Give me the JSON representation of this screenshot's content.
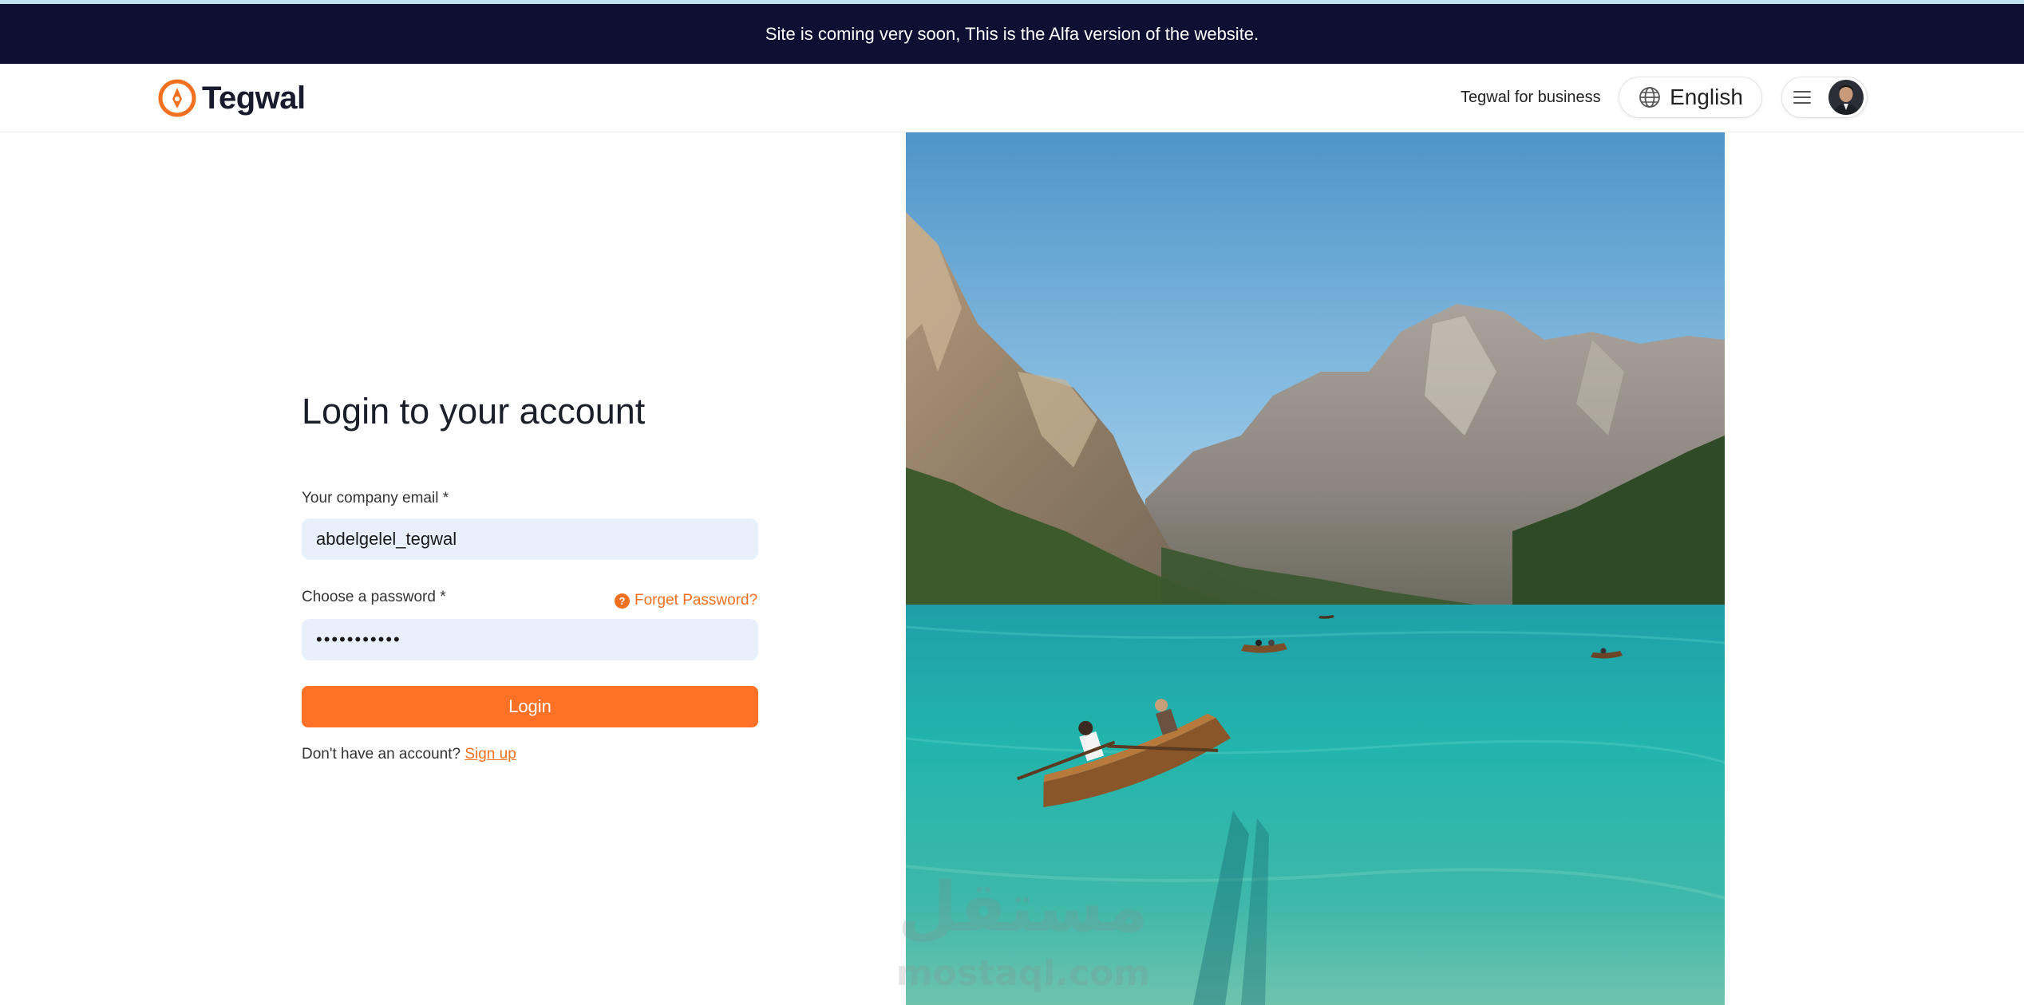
{
  "banner": {
    "text": "Site is coming very soon, This is the Alfa version of the website."
  },
  "header": {
    "brand": "Tegwal",
    "business_link": "Tegwal for business",
    "language": "English"
  },
  "login": {
    "title": "Login to your account",
    "email_label": "Your company email *",
    "email_value": "abdelgelel_tegwal",
    "password_label": "Choose a password *",
    "password_value": "•••••••••••",
    "forgot_label": "Forget Password?",
    "forgot_icon": "?",
    "submit_label": "Login",
    "no_account_text": "Don't have an account?",
    "signup_link": "Sign up"
  },
  "watermark": {
    "arabic": "مستقل",
    "latin": "mostaql.com"
  },
  "colors": {
    "banner_bg": "#0d0f33",
    "accent": "#ff7127",
    "input_bg": "#e8f0fe"
  },
  "icons": {
    "logo": "compass-pin-icon",
    "language": "globe-icon",
    "menu": "hamburger-icon",
    "forgot": "question-circle-icon"
  }
}
